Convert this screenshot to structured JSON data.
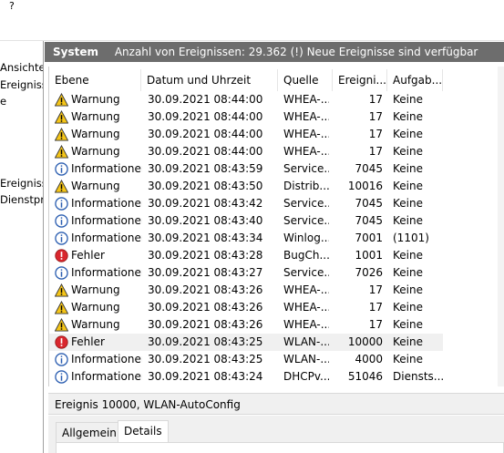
{
  "menu": {
    "help": "?"
  },
  "left_pane": {
    "items": [
      "Ansichter",
      "Ereignisse",
      "e",
      "Ereignisse",
      "Dienstpro"
    ]
  },
  "header": {
    "title": "System",
    "info": "Anzahl von Ereignissen: 29.362 (!) Neue Ereignisse sind verfügbar"
  },
  "columns": [
    "Ebene",
    "Datum und Uhrzeit",
    "Quelle",
    "Ereigni...",
    "Aufgab..."
  ],
  "events": [
    {
      "level": "Warnung",
      "icon": "warning-icon",
      "date": "30.09.2021 08:44:00",
      "source": "WHEA-...",
      "id": "17",
      "task": "Keine"
    },
    {
      "level": "Warnung",
      "icon": "warning-icon",
      "date": "30.09.2021 08:44:00",
      "source": "WHEA-...",
      "id": "17",
      "task": "Keine"
    },
    {
      "level": "Warnung",
      "icon": "warning-icon",
      "date": "30.09.2021 08:44:00",
      "source": "WHEA-...",
      "id": "17",
      "task": "Keine"
    },
    {
      "level": "Warnung",
      "icon": "warning-icon",
      "date": "30.09.2021 08:44:00",
      "source": "WHEA-...",
      "id": "17",
      "task": "Keine"
    },
    {
      "level": "Informationen",
      "icon": "info-icon",
      "date": "30.09.2021 08:43:59",
      "source": "Service...",
      "id": "7045",
      "task": "Keine"
    },
    {
      "level": "Warnung",
      "icon": "warning-icon",
      "date": "30.09.2021 08:43:50",
      "source": "Distrib...",
      "id": "10016",
      "task": "Keine"
    },
    {
      "level": "Informationen",
      "icon": "info-icon",
      "date": "30.09.2021 08:43:42",
      "source": "Service...",
      "id": "7045",
      "task": "Keine"
    },
    {
      "level": "Informationen",
      "icon": "info-icon",
      "date": "30.09.2021 08:43:40",
      "source": "Service...",
      "id": "7045",
      "task": "Keine"
    },
    {
      "level": "Informationen",
      "icon": "info-icon",
      "date": "30.09.2021 08:43:34",
      "source": "Winlog...",
      "id": "7001",
      "task": "(1101)"
    },
    {
      "level": "Fehler",
      "icon": "error-icon",
      "date": "30.09.2021 08:43:28",
      "source": "BugCh...",
      "id": "1001",
      "task": "Keine"
    },
    {
      "level": "Informationen",
      "icon": "info-icon",
      "date": "30.09.2021 08:43:27",
      "source": "Service...",
      "id": "7026",
      "task": "Keine"
    },
    {
      "level": "Warnung",
      "icon": "warning-icon",
      "date": "30.09.2021 08:43:26",
      "source": "WHEA-...",
      "id": "17",
      "task": "Keine"
    },
    {
      "level": "Warnung",
      "icon": "warning-icon",
      "date": "30.09.2021 08:43:26",
      "source": "WHEA-...",
      "id": "17",
      "task": "Keine"
    },
    {
      "level": "Warnung",
      "icon": "warning-icon",
      "date": "30.09.2021 08:43:26",
      "source": "WHEA-...",
      "id": "17",
      "task": "Keine"
    },
    {
      "level": "Fehler",
      "icon": "error-icon",
      "date": "30.09.2021 08:43:25",
      "source": "WLAN-...",
      "id": "10000",
      "task": "Keine",
      "selected": true
    },
    {
      "level": "Informationen",
      "icon": "info-icon",
      "date": "30.09.2021 08:43:25",
      "source": "WLAN-...",
      "id": "4000",
      "task": "Keine"
    },
    {
      "level": "Informationen",
      "icon": "info-icon",
      "date": "30.09.2021 08:43:24",
      "source": "DHCPv...",
      "id": "51046",
      "task": "Diensts..."
    }
  ],
  "detail": {
    "title": "Ereignis 10000, WLAN-AutoConfig",
    "tabs": [
      "Allgemein",
      "Details"
    ],
    "active_tab": "Details"
  },
  "colors": {
    "header_bg": "#6d6d6d",
    "warning": "#f5c518",
    "error": "#d9272e",
    "info": "#2a5db0",
    "selected_row": "#f0f0f0"
  }
}
